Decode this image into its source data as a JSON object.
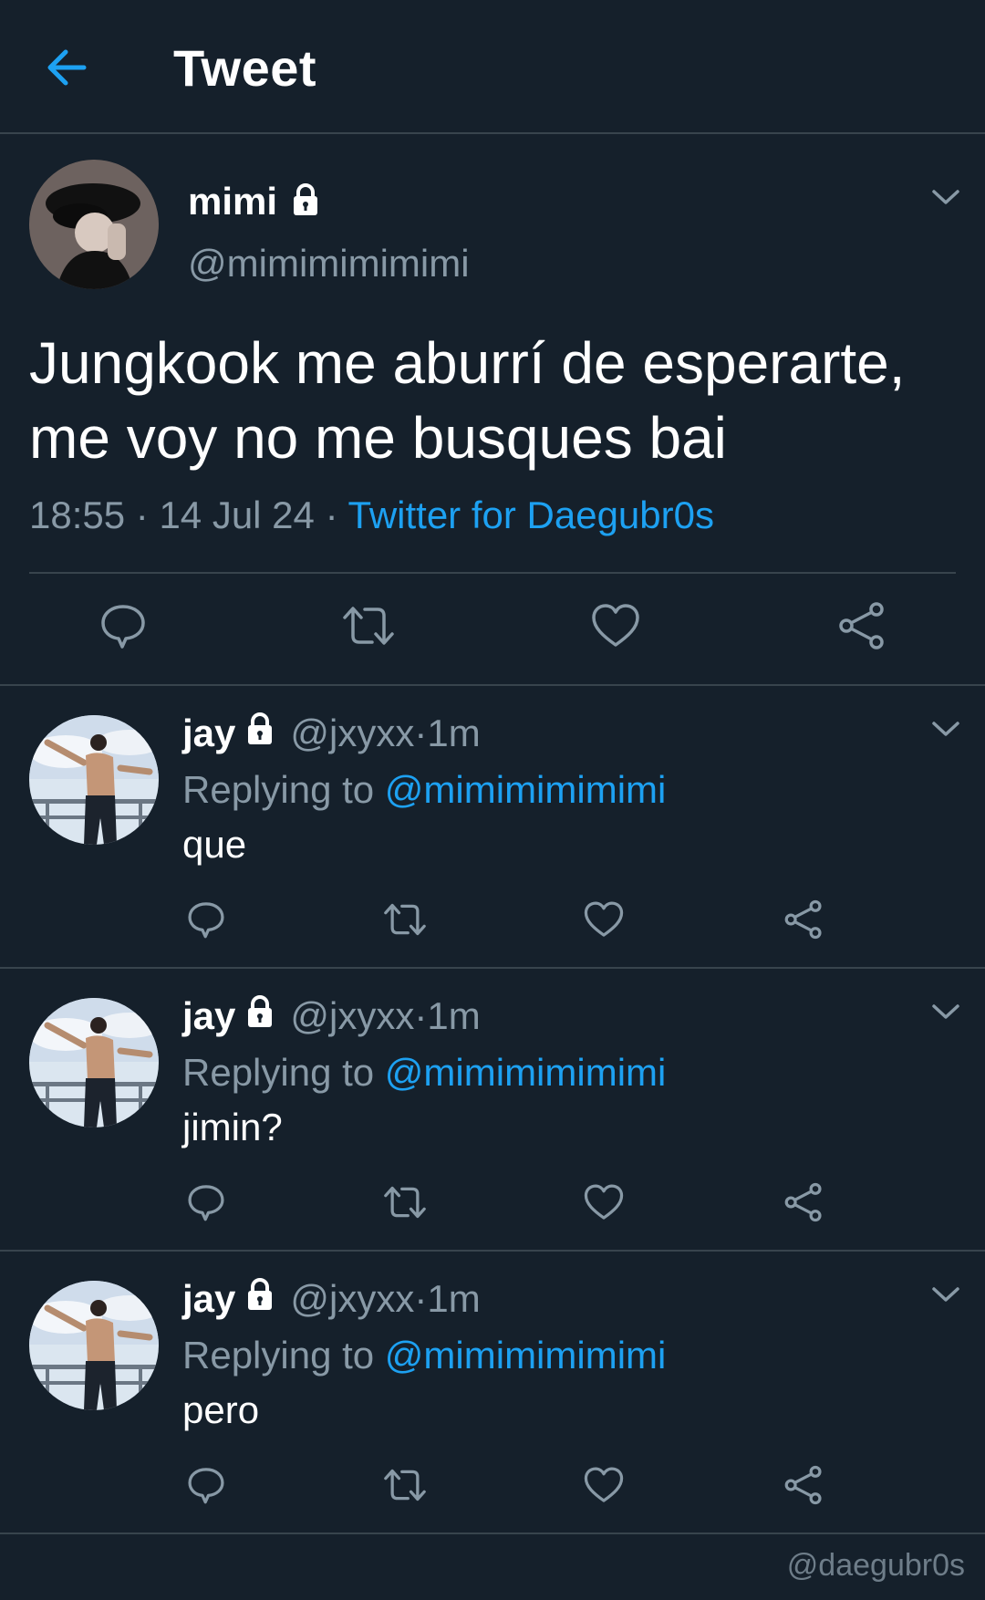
{
  "header": {
    "title": "Tweet"
  },
  "main_tweet": {
    "name": "mimi",
    "handle": "@mimimimimimi",
    "text": "Jungkook me aburrí de esperarte, me voy no me busques bai",
    "time": "18:55",
    "date": "14 Jul 24",
    "source": "Twitter for Daegubr0s",
    "separator": " · "
  },
  "replies": [
    {
      "name": "jay",
      "handle": "@jxyxx",
      "time": "1m",
      "replying_label": "Replying to ",
      "replying_to": "@mimimimimimi",
      "text": "que"
    },
    {
      "name": "jay",
      "handle": "@jxyxx",
      "time": "1m",
      "replying_label": "Replying to ",
      "replying_to": "@mimimimimimi",
      "text": "jimin?"
    },
    {
      "name": "jay",
      "handle": "@jxyxx",
      "time": "1m",
      "replying_label": "Replying to ",
      "replying_to": "@mimimimimimi",
      "text": "pero"
    }
  ],
  "watermark": "@daegubr0s",
  "icons": {
    "back": "arrow-left-icon",
    "lock": "lock-icon",
    "caret": "chevron-down-icon",
    "reply": "comment-icon",
    "retweet": "retweet-icon",
    "like": "heart-icon",
    "share": "share-icon"
  },
  "colors": {
    "background": "#15202b",
    "accent": "#1da1f2",
    "secondary_text": "#8899a6",
    "divider": "#38444d"
  }
}
